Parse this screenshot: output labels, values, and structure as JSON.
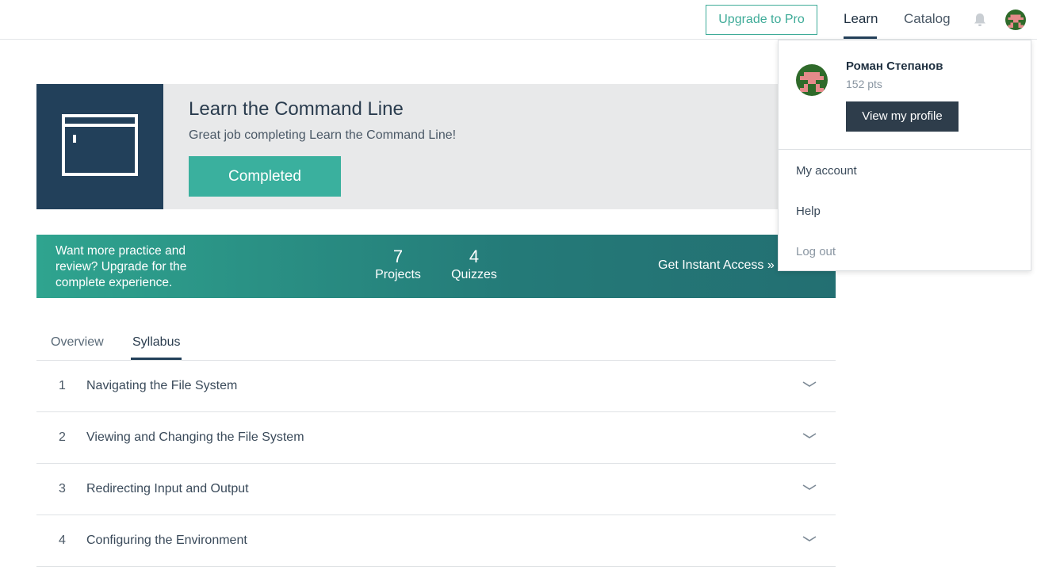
{
  "nav": {
    "upgrade_label": "Upgrade to Pro",
    "learn_label": "Learn",
    "catalog_label": "Catalog"
  },
  "course": {
    "title": "Learn the Command Line",
    "subtitle": "Great job completing Learn the Command Line!",
    "status_label": "Completed"
  },
  "promo": {
    "text": "Want more practice and review? Upgrade for the complete experience.",
    "projects_count": "7",
    "projects_label": "Projects",
    "quizzes_count": "4",
    "quizzes_label": "Quizzes",
    "cta_label": "Get Instant Access »"
  },
  "tabs": [
    {
      "label": "Overview"
    },
    {
      "label": "Syllabus"
    }
  ],
  "syllabus": [
    {
      "number": "1",
      "title": "Navigating the File System"
    },
    {
      "number": "2",
      "title": "Viewing and Changing the File System"
    },
    {
      "number": "3",
      "title": "Redirecting Input and Output"
    },
    {
      "number": "4",
      "title": "Configuring the Environment"
    }
  ],
  "user_menu": {
    "name": "Роман Степанов",
    "points": "152 pts",
    "profile_button": "View my profile",
    "links": [
      {
        "label": "My account"
      },
      {
        "label": "Help"
      },
      {
        "label": "Log out"
      }
    ]
  },
  "colors": {
    "accent": "#3ab09e",
    "navy": "#22405a",
    "avatar_bg": "#2f6a2a",
    "avatar_fg": "#e58a8a"
  }
}
